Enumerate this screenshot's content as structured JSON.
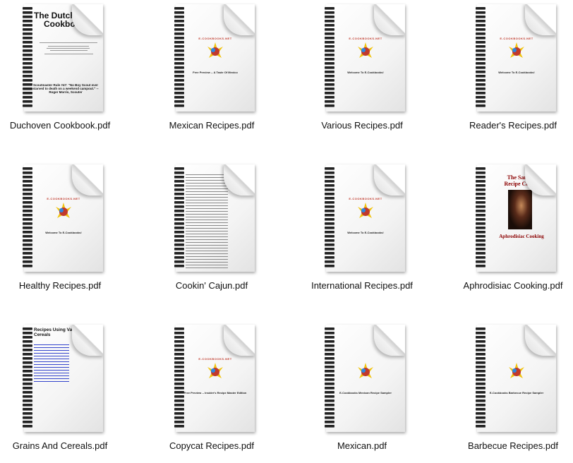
{
  "files": [
    {
      "name": "Duchoven Cookbook.pdf",
      "style": "dutch",
      "title_line1": "The Dutch O",
      "title_line2": "Cookbook",
      "quote": "Scoutmaster Rule #47: \"No Boy Scout ever starved to death on a weekend campout.\" -- Roger Morris, Scouter"
    },
    {
      "name": "Mexican Recipes.pdf",
      "style": "ecook",
      "heading": "Free Preview -- A Taste Of Mexico"
    },
    {
      "name": "Various Recipes.pdf",
      "style": "ecook",
      "heading": "Welcome To E-Cookbooks!"
    },
    {
      "name": "Reader's Recipes.pdf",
      "style": "ecook",
      "heading": "Welcome To E-Cookbooks!"
    },
    {
      "name": "Healthy Recipes.pdf",
      "style": "ecook",
      "heading": "Welcome To E-Cookbooks!"
    },
    {
      "name": "Cookin' Cajun.pdf",
      "style": "list"
    },
    {
      "name": "International Recipes.pdf",
      "style": "ecook",
      "heading": "Welcome To E-Cookbooks!"
    },
    {
      "name": "Aphrodisiac Cooking.pdf",
      "style": "aph",
      "title_line1": "The Santess",
      "title_line2": "Recipe Collect",
      "subtitle": "Aphrodisiac Cooking"
    },
    {
      "name": "Grains And Cereals.pdf",
      "style": "grains",
      "title_line1": "Recipes Using Various Grain",
      "title_line2": "Cereals"
    },
    {
      "name": "Copycat Recipes.pdf",
      "style": "ecook",
      "heading": "Free Preview -- Insider's Recipe Master Edition"
    },
    {
      "name": "Mexican.pdf",
      "style": "ecook",
      "heading": "E-Cookbooks Mexican Recipe Sampler"
    },
    {
      "name": "Barbecue Recipes.pdf",
      "style": "ecook",
      "heading": "E-Cookbooks Barbecue Recipe Sampler"
    }
  ],
  "logo_text": "E-COOKBOOKS.NET"
}
